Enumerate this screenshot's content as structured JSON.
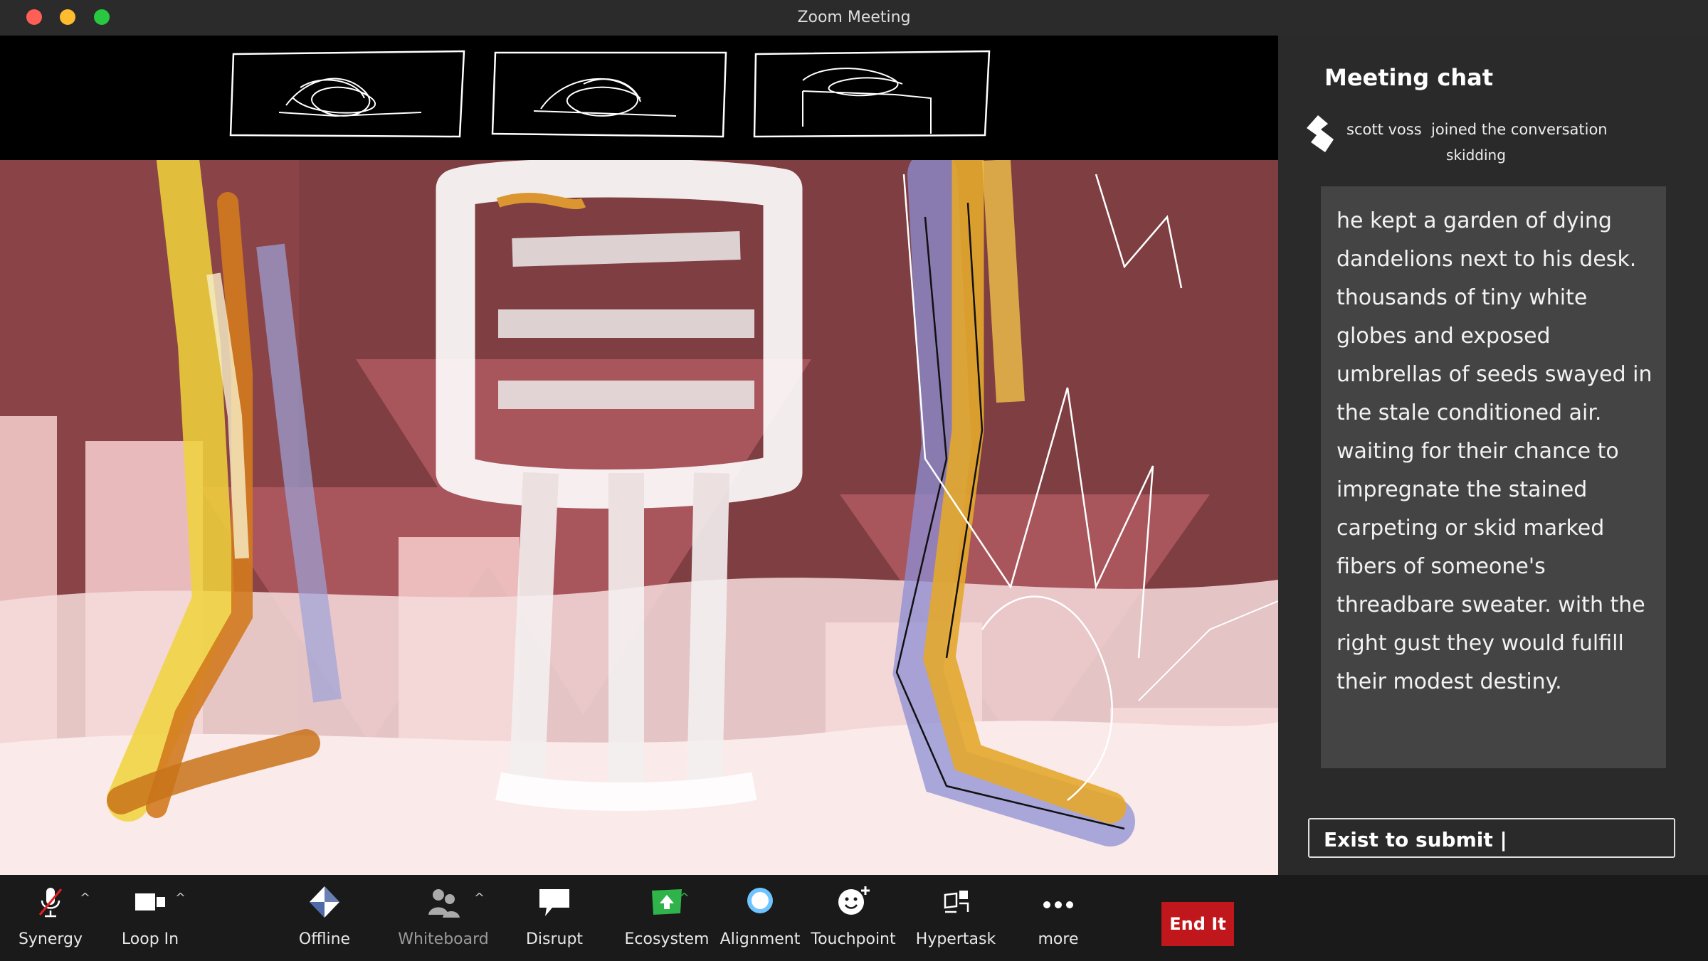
{
  "window": {
    "title": "Zoom Meeting"
  },
  "colors": {
    "end_button": "#c0171c",
    "accent_green": "#2fb34a",
    "accent_blue": "#6fc4ff"
  },
  "chat": {
    "title": "Meeting chat",
    "notice_user": "scott voss",
    "notice_text": "joined the conversation",
    "notice_sub": "skidding",
    "message": "he kept a garden of dying dandelions next to his desk. thousands of tiny white globes and exposed umbrellas of seeds swayed in the stale conditioned air. waiting for their chance to impregnate the stained carpeting or skid marked fibers of someone's threadbare sweater. with the right gust they would fulfill their modest destiny.",
    "input_value": "Exist to submit |"
  },
  "toolbar": {
    "synergy": {
      "label": "Synergy",
      "icon": "muted-microphone-icon"
    },
    "loop_in": {
      "label": "Loop In",
      "icon": "video-camera-icon"
    },
    "offline": {
      "label": "Offline",
      "icon": "diamond-icon"
    },
    "whiteboard": {
      "label": "Whiteboard",
      "icon": "participants-icon"
    },
    "disrupt": {
      "label": "Disrupt",
      "icon": "speech-bubble-icon"
    },
    "ecosystem": {
      "label": "Ecosystem",
      "icon": "share-screen-icon"
    },
    "alignment": {
      "label": "Alignment",
      "icon": "record-circle-icon"
    },
    "touchpoint": {
      "label": "Touchpoint",
      "icon": "reaction-icon"
    },
    "hypertask": {
      "label": "Hypertask",
      "icon": "apps-icon"
    },
    "more": {
      "label": "more",
      "icon": "more-dots-icon"
    },
    "end": {
      "label": "End It"
    }
  }
}
